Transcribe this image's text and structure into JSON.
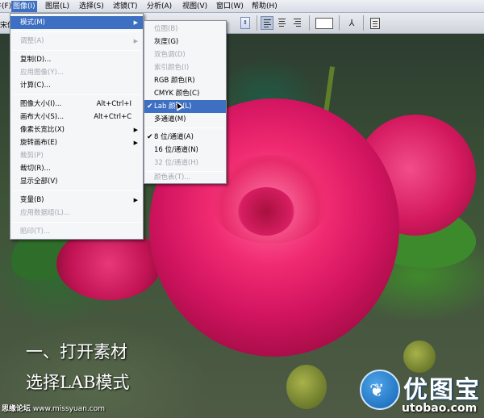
{
  "menubar": {
    "items": [
      {
        "label": "文件(F)"
      },
      {
        "label": "图像(I)"
      },
      {
        "label": "图层(L)"
      },
      {
        "label": "选择(S)"
      },
      {
        "label": "滤镜(T)"
      },
      {
        "label": "分析(A)"
      },
      {
        "label": "视图(V)"
      },
      {
        "label": "窗口(W)"
      },
      {
        "label": "帮助(H)"
      }
    ]
  },
  "options_bar": {
    "font_label": "宋体"
  },
  "image_menu": {
    "items": [
      {
        "label": "模式(M)",
        "shortcut": "",
        "submenu": true,
        "disabled": false
      },
      {
        "label": "调整(A)",
        "shortcut": "",
        "submenu": true,
        "disabled": true
      },
      {
        "label": "复制(D)...",
        "shortcut": "",
        "submenu": false,
        "disabled": false
      },
      {
        "label": "应用图像(Y)...",
        "shortcut": "",
        "submenu": false,
        "disabled": true
      },
      {
        "label": "计算(C)...",
        "shortcut": "",
        "submenu": false,
        "disabled": false
      },
      {
        "label": "图像大小(I)...",
        "shortcut": "Alt+Ctrl+I",
        "submenu": false,
        "disabled": false
      },
      {
        "label": "画布大小(S)...",
        "shortcut": "Alt+Ctrl+C",
        "submenu": false,
        "disabled": false
      },
      {
        "label": "像素长宽比(X)",
        "shortcut": "",
        "submenu": true,
        "disabled": false
      },
      {
        "label": "旋转画布(E)",
        "shortcut": "",
        "submenu": true,
        "disabled": false
      },
      {
        "label": "裁剪(P)",
        "shortcut": "",
        "submenu": false,
        "disabled": true
      },
      {
        "label": "裁切(R)...",
        "shortcut": "",
        "submenu": false,
        "disabled": false
      },
      {
        "label": "显示全部(V)",
        "shortcut": "",
        "submenu": false,
        "disabled": false
      },
      {
        "label": "变量(B)",
        "shortcut": "",
        "submenu": true,
        "disabled": false
      },
      {
        "label": "应用数据组(L)...",
        "shortcut": "",
        "submenu": false,
        "disabled": true
      },
      {
        "label": "陷印(T)...",
        "shortcut": "",
        "submenu": false,
        "disabled": true
      }
    ]
  },
  "mode_menu": {
    "items": [
      {
        "label": "位图(B)",
        "disabled": true,
        "checked": false
      },
      {
        "label": "灰度(G)",
        "disabled": false,
        "checked": false
      },
      {
        "label": "双色调(D)",
        "disabled": true,
        "checked": false
      },
      {
        "label": "索引颜色(I)",
        "disabled": true,
        "checked": false
      },
      {
        "label": "RGB 颜色(R)",
        "disabled": false,
        "checked": false
      },
      {
        "label": "CMYK 颜色(C)",
        "disabled": false,
        "checked": false
      },
      {
        "label": "Lab 颜色(L)",
        "disabled": false,
        "checked": true,
        "highlighted": true
      },
      {
        "label": "多通道(M)",
        "disabled": false,
        "checked": false
      },
      {
        "label": "8 位/通道(A)",
        "disabled": false,
        "checked": true
      },
      {
        "label": "16 位/通道(N)",
        "disabled": false,
        "checked": false
      },
      {
        "label": "32 位/通道(H)",
        "disabled": true,
        "checked": false
      },
      {
        "label": "颜色表(T)...",
        "disabled": true,
        "checked": false
      }
    ]
  },
  "captions": {
    "line1": "一、打开素材",
    "line2": "选择LAB模式"
  },
  "watermark": {
    "site_name": "思缘论坛",
    "site_url": "www.missyuan.com"
  },
  "logo": {
    "brand": "优图宝",
    "url": "utobao.com"
  },
  "colors": {
    "highlight": "#3d6fc2",
    "menu_bg": "#f5f6f8",
    "disabled_text": "#a3a7ae"
  }
}
